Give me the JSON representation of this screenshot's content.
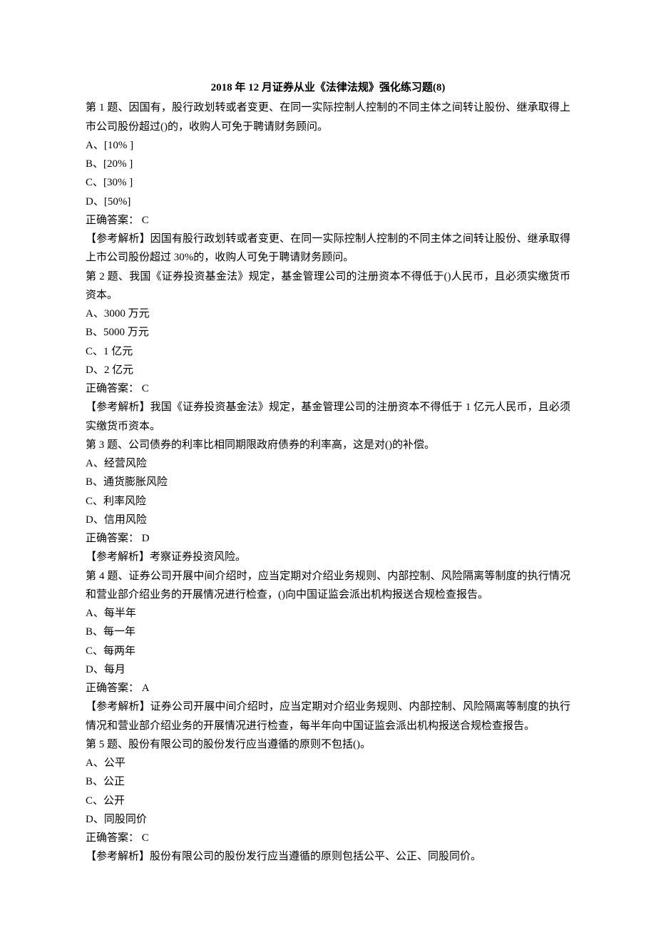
{
  "title": "2018 年 12 月证券从业《法律法规》强化练习题(8)",
  "questions": [
    {
      "header": "第 1 题、因国有，股行政划转或者变更、在同一实际控制人控制的不同主体之间转让股份、继承取得上市公司股份超过()的，收购人可免于聘请财务顾问。",
      "options": [
        "A、[10% ]",
        "B、[20% ]",
        "C、[30% ]",
        "D、[50%]"
      ],
      "answer": "正确答案：  C",
      "analysis": "【参考解析】因国有股行政划转或者变更、在同一实际控制人控制的不同主体之间转让股份、继承取得上市公司股份超过 30%的，收购人可免于聘请财务顾问。"
    },
    {
      "header": "第 2 题、我国《证券投资基金法》规定，基金管理公司的注册资本不得低于()人民币，且必须实缴货币资本。",
      "options": [
        "A、3000 万元",
        "B、5000 万元",
        "C、1 亿元",
        "D、2 亿元"
      ],
      "answer": "正确答案：  C",
      "analysis": "【参考解析】我国《证券投资基金法》规定，基金管理公司的注册资本不得低于 1 亿元人民币，且必须实缴货币资本。"
    },
    {
      "header": "第 3 题、公司债券的利率比相同期限政府债券的利率高，这是对()的补偿。",
      "options": [
        "A、经营风险",
        "B、通货膨胀风险",
        "C、利率风险",
        "D、信用风险"
      ],
      "answer": "正确答案：  D",
      "analysis": "【参考解析】考察证券投资风险。"
    },
    {
      "header": "第 4 题、证券公司开展中间介绍时，应当定期对介绍业务规则、内部控制、风险隔离等制度的执行情况和营业部介绍业务的开展情况进行检查，()向中国证监会派出机构报送合规检查报告。",
      "options": [
        "A、每半年",
        "B、每一年",
        "C、每两年",
        "D、每月"
      ],
      "answer": "正确答案：  A",
      "analysis": "【参考解析】证券公司开展中间介绍时，应当定期对介绍业务规则、内部控制、风险隔离等制度的执行情况和营业部介绍业务的开展情况进行检查，每半年向中国证监会派出机构报送合规检查报告。"
    },
    {
      "header": "第 5 题、股份有限公司的股份发行应当遵循的原则不包括()。",
      "options": [
        "A、公平",
        "B、公正",
        "C、公开",
        "D、同股同价"
      ],
      "answer": "正确答案：  C",
      "analysis": "【参考解析】股份有限公司的股份发行应当遵循的原则包括公平、公正、同股同价。"
    }
  ]
}
